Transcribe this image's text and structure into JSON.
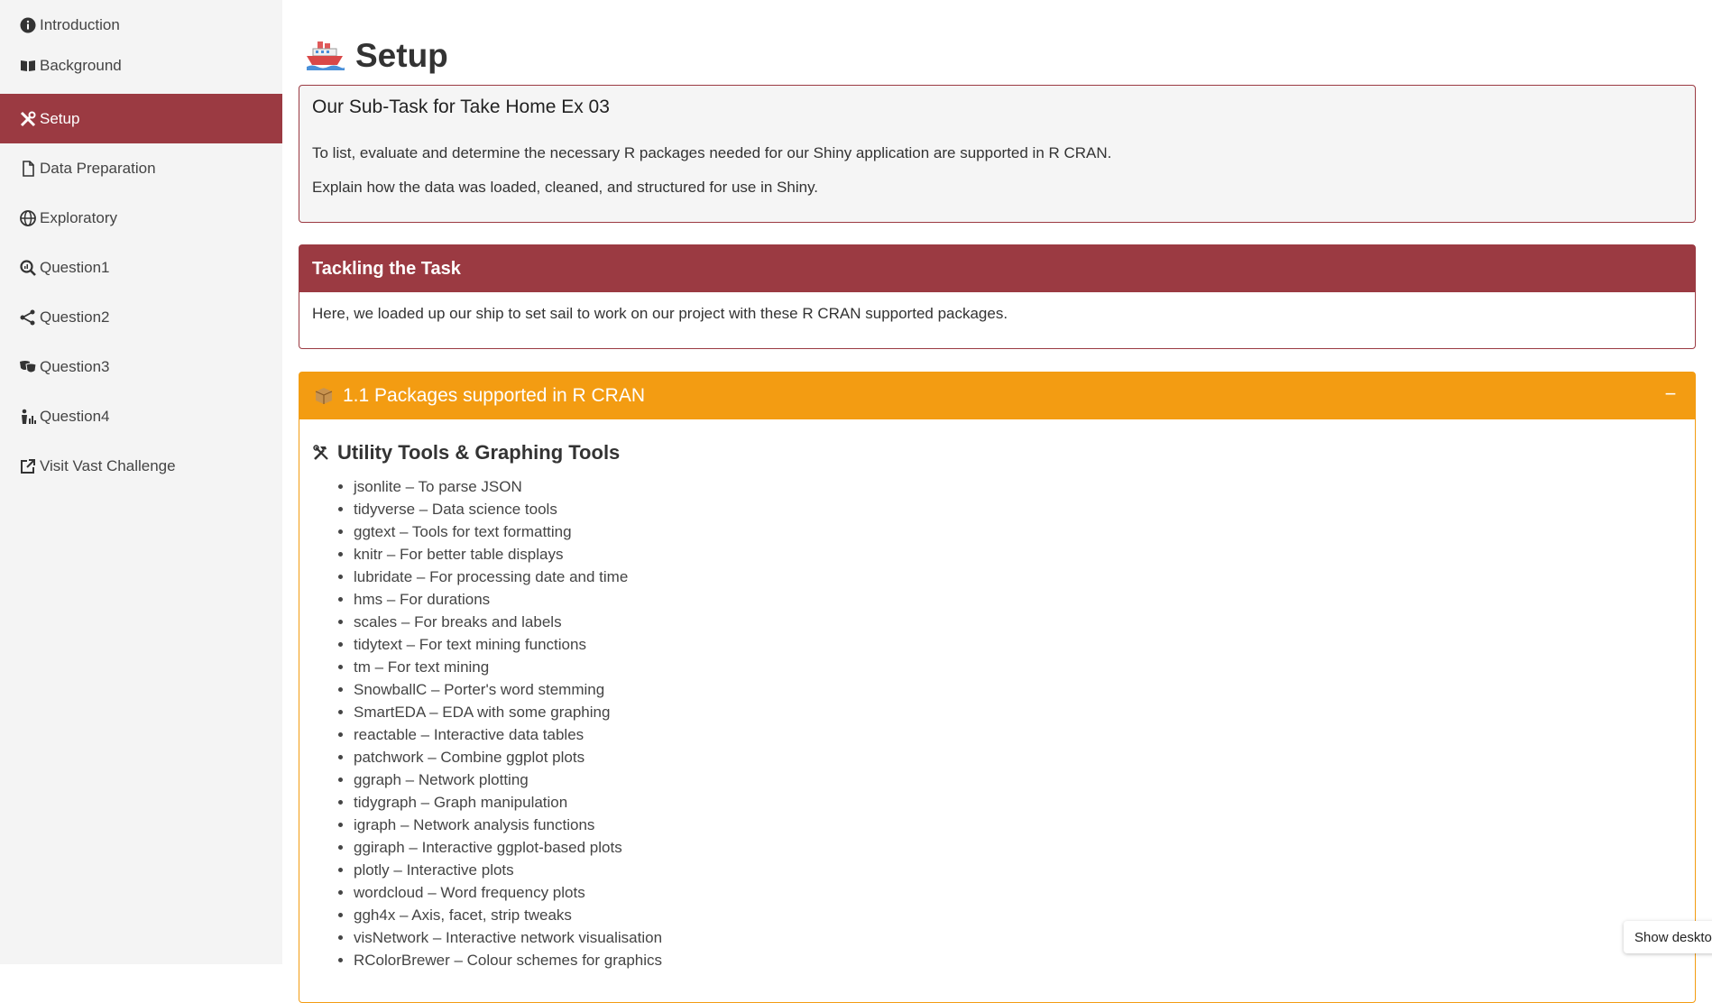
{
  "sidebar": {
    "items": [
      {
        "label": "Introduction",
        "icon": "info-circle-icon"
      },
      {
        "label": "Background",
        "icon": "book-open-icon"
      },
      {
        "label": "Setup",
        "icon": "tools-icon"
      },
      {
        "label": "Data Preparation",
        "icon": "file-icon"
      },
      {
        "label": "Exploratory",
        "icon": "globe-icon"
      },
      {
        "label": "Question1",
        "icon": "search-chart-icon"
      },
      {
        "label": "Question2",
        "icon": "share-nodes-icon"
      },
      {
        "label": "Question3",
        "icon": "masks-icon"
      },
      {
        "label": "Question4",
        "icon": "person-chart-icon"
      },
      {
        "label": "Visit Vast Challenge",
        "icon": "external-link-icon"
      }
    ],
    "active_index": 2
  },
  "page": {
    "title": "Setup",
    "title_icon": "ship-icon"
  },
  "subtask_box": {
    "title": "Our Sub-Task for Take Home Ex 03",
    "paragraph1": "To list, evaluate and determine the necessary R packages needed for our Shiny application are supported in R CRAN.",
    "paragraph2": "Explain how the data was loaded, cleaned, and structured for use in Shiny."
  },
  "tackling_box": {
    "title": "Tackling the Task",
    "body": "Here, we loaded up our ship to set sail to work on our project with these R CRAN supported packages."
  },
  "packages_box": {
    "title": "1.1 Packages supported in R CRAN",
    "title_icon": "package-icon",
    "collapse_label": "−",
    "section_title": "Utility Tools & Graphing Tools",
    "section_icon": "hammer-wrench-icon",
    "packages": [
      "jsonlite – To parse JSON",
      "tidyverse – Data science tools",
      "ggtext – Tools for text formatting",
      "knitr – For better table displays",
      "lubridate – For processing date and time",
      "hms – For durations",
      "scales – For breaks and labels",
      "tidytext – For text mining functions",
      "tm – For text mining",
      "SnowballC – Porter's word stemming",
      "SmartEDA – EDA with some graphing",
      "reactable – Interactive data tables",
      "patchwork – Combine ggplot plots",
      "ggraph – Network plotting",
      "tidygraph – Graph manipulation",
      "igraph – Network analysis functions",
      "ggiraph – Interactive ggplot-based plots",
      "plotly – Interactive plots",
      "wordcloud – Word frequency plots",
      "ggh4x – Axis, facet, strip tweaks",
      "visNetwork – Interactive network visualisation",
      "RColorBrewer – Colour schemes for graphics"
    ]
  },
  "taskbar_tooltip": "Show desktop",
  "colors": {
    "accent": "#9b3a42",
    "warning": "#f39c12",
    "sidebar_bg": "#f4f4f4"
  }
}
